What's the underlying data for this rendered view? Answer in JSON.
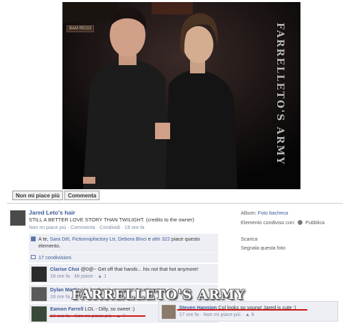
{
  "photo": {
    "watermark_vertical": "FARRELLETO'S ARMY",
    "sign_text": "BAM REGO"
  },
  "actions": {
    "unlike": "Non mi piace più",
    "comment": "Commenta"
  },
  "post": {
    "author": "Jared Leto's hair",
    "text": "STILL A BETTER LOVE STORY THAN TWILIGHT. (credits to the owner)",
    "unlike": "Non mi piace più",
    "sep1": "·",
    "comment": "Commenta",
    "sep2": "·",
    "share": "Condividi",
    "sep3": "·",
    "time": "18 ore fa"
  },
  "sidebar": {
    "album_label": "Album:",
    "album_value": "Foto bacheca",
    "shared_label": "Elemento condiviso con:",
    "shared_value": "Pubblica",
    "download": "Scarica",
    "report": "Segnala questa foto"
  },
  "likes": {
    "prefix": "A te, ",
    "names": [
      "Sara Dèl",
      "Fictionvipfactory Ltr",
      "Debora Binci"
    ],
    "sep": ", ",
    "and": " e ",
    "others": "altri 322",
    "suffix": " piace questo elemento."
  },
  "shares": {
    "label": "17 condivisioni"
  },
  "comments": [
    {
      "name": "Clarise Choi",
      "text": "@0@~ Get off that hands... his not that hot anymore!",
      "time": "18 ore fa",
      "like": "Mi piace",
      "count": "1"
    },
    {
      "name": "Dylan Martin",
      "text": "His brother is my agent! Amazing man...",
      "time": "18 ore fa",
      "like": "",
      "count": ""
    },
    {
      "name": "Eamon Farrell",
      "text": "LOL - Dilly, so sweet :)",
      "time": "18 ore fa",
      "like": "Non mi piace più",
      "count": "7"
    }
  ],
  "popout": {
    "name": "Steven Hannion",
    "text": "Col looks so young! Jared is cute ;)",
    "time": "17 ore fa",
    "like": "Non mi piace più",
    "count": "6"
  },
  "watermark_big": "FARRELLETO'S ARMY",
  "colors": {
    "link": "#3b5998",
    "highlight": "#d01010",
    "panel": "#edeff4"
  }
}
